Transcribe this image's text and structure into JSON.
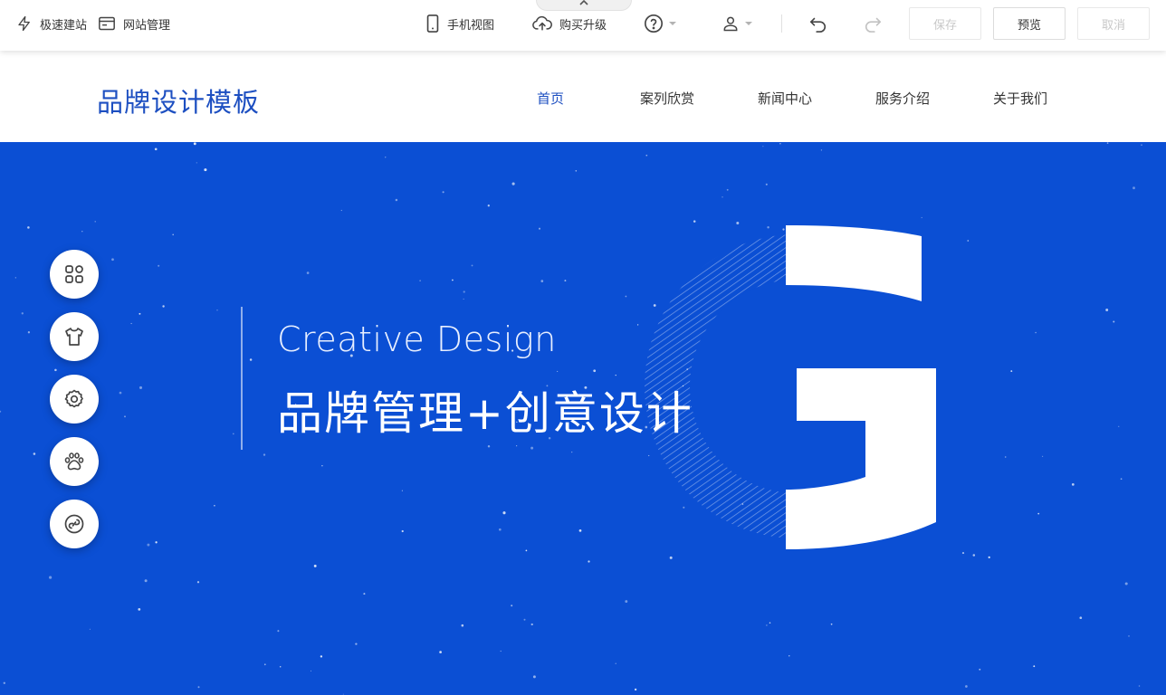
{
  "toolbar": {
    "quick_build": "极速建站",
    "site_manage": "网站管理",
    "mobile_view": "手机视图",
    "buy_upgrade": "购买升级",
    "save": "保存",
    "preview": "预览",
    "cancel": "取消"
  },
  "site": {
    "brand": "品牌设计模板",
    "nav": [
      "首页",
      "案列欣赏",
      "新闻中心",
      "服务介绍",
      "关于我们"
    ]
  },
  "hero": {
    "subtitle": "Creative Design",
    "title": "品牌管理+创意设计"
  },
  "colors": {
    "brand_blue": "#1d4fc1",
    "hero_bg": "#0b4fd4"
  },
  "float_tools": [
    "grid-icon",
    "shirt-icon",
    "gear-icon",
    "paw-icon",
    "link-icon"
  ]
}
